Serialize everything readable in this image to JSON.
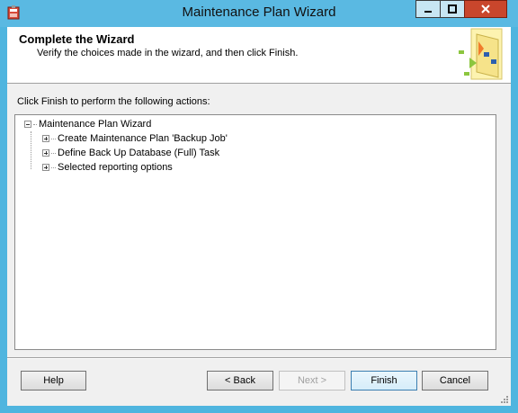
{
  "window": {
    "title": "Maintenance Plan Wizard"
  },
  "header": {
    "title": "Complete the Wizard",
    "subtitle": "Verify the choices made in the wizard, and then click Finish."
  },
  "instruction": "Click Finish to perform the following actions:",
  "tree": {
    "root": "Maintenance Plan Wizard",
    "children": [
      "Create Maintenance Plan 'Backup Job'",
      "Define Back Up Database (Full) Task",
      "Selected reporting options"
    ]
  },
  "buttons": {
    "help": "Help",
    "back": "< Back",
    "next": "Next >",
    "finish": "Finish",
    "cancel": "Cancel"
  }
}
